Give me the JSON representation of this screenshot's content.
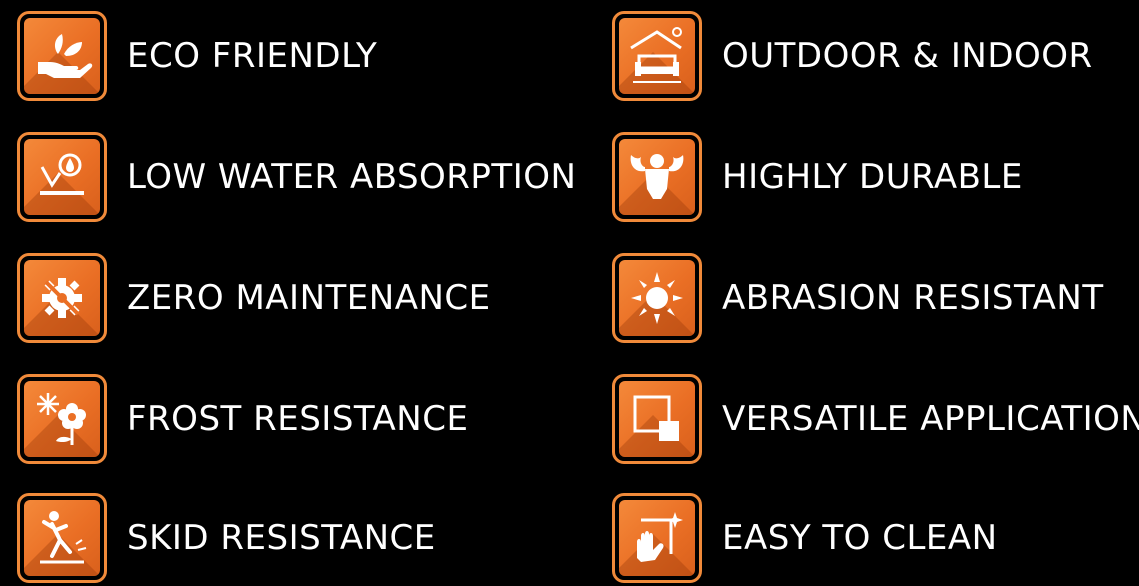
{
  "features": [
    {
      "label": "ECO FRIENDLY",
      "icon": "hand-leaf-icon"
    },
    {
      "label": "OUTDOOR & INDOOR",
      "icon": "sofa-house-icon"
    },
    {
      "label": "LOW WATER ABSORPTION",
      "icon": "water-drop-icon"
    },
    {
      "label": "HIGHLY DURABLE",
      "icon": "muscle-man-icon"
    },
    {
      "label": "ZERO MAINTENANCE",
      "icon": "gear-slash-icon"
    },
    {
      "label": "ABRASION RESISTANT",
      "icon": "sun-icon"
    },
    {
      "label": "FROST RESISTANCE",
      "icon": "snowflake-flower-icon"
    },
    {
      "label": "VERSATILE APPLICATION",
      "icon": "tiles-icon"
    },
    {
      "label": "SKID RESISTANCE",
      "icon": "slipping-person-icon"
    },
    {
      "label": "EASY TO CLEAN",
      "icon": "wiping-hand-icon"
    }
  ],
  "colors": {
    "background": "#000000",
    "accent": "#f08a3a",
    "text": "#ffffff"
  }
}
